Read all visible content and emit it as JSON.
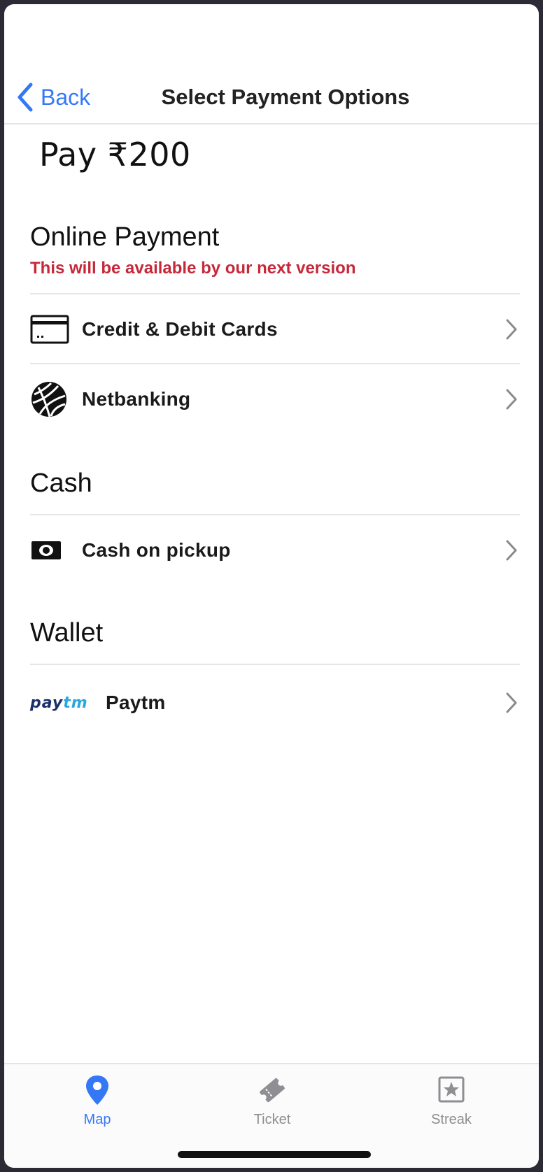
{
  "navbar": {
    "back_label": "Back",
    "title": "Select Payment Options"
  },
  "pay": {
    "amount_text": "Pay ₹200"
  },
  "sections": {
    "online": {
      "title": "Online Payment",
      "note": "This will be available by our next version",
      "items": [
        {
          "label": "Credit & Debit Cards",
          "icon": "credit-card-icon"
        },
        {
          "label": "Netbanking",
          "icon": "globe-icon"
        }
      ]
    },
    "cash": {
      "title": "Cash",
      "items": [
        {
          "label": "Cash on pickup",
          "icon": "cash-icon"
        }
      ]
    },
    "wallet": {
      "title": "Wallet",
      "items": [
        {
          "label": "Paytm",
          "icon": "paytm-logo",
          "logo_text_a": "pay",
          "logo_text_b": "tm"
        }
      ]
    }
  },
  "tabbar": {
    "tabs": [
      {
        "label": "Map",
        "icon": "map-pin-icon",
        "active": true
      },
      {
        "label": "Ticket",
        "icon": "ticket-icon",
        "active": false
      },
      {
        "label": "Streak",
        "icon": "star-icon",
        "active": false
      }
    ]
  },
  "colors": {
    "accent": "#3478f6",
    "warning": "#c6283a",
    "inactive": "#8e8e93"
  }
}
